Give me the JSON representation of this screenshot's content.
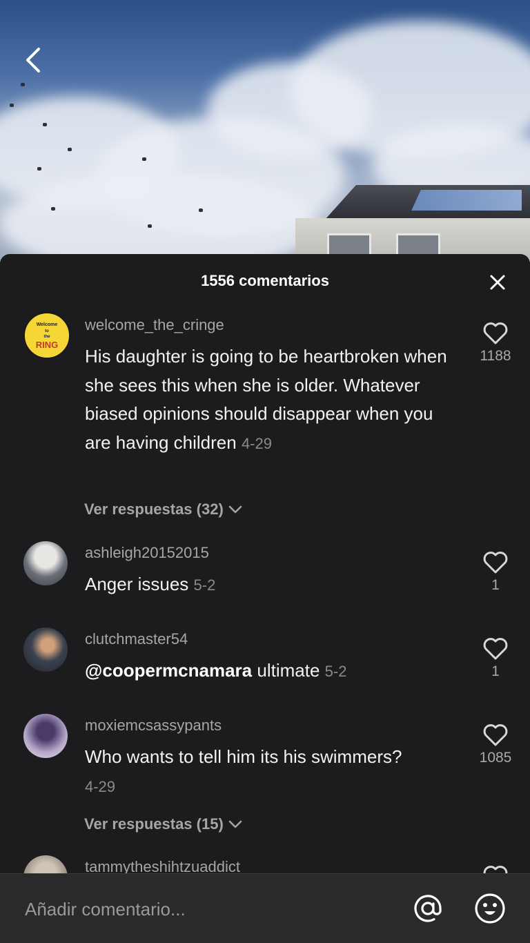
{
  "panel": {
    "title": "1556 comentarios"
  },
  "comments": [
    {
      "username": "welcome_the_cringe",
      "text": "His daughter is going to be heartbroken when she sees this when she is older. Whatever biased opinions should disappear when you are having children",
      "date": "4-29",
      "likes": "1188",
      "replies": "Ver respuestas (32)",
      "avatar_text": [
        "Welcome",
        "to",
        "the",
        "RING"
      ]
    },
    {
      "username": "ashleigh20152015",
      "text": "Anger issues",
      "date": "5-2",
      "likes": "1"
    },
    {
      "username": "clutchmaster54",
      "mention": "@coopermcnamara",
      "text": "ultimate",
      "date": "5-2",
      "likes": "1"
    },
    {
      "username": "moxiemcsassypants",
      "text": "Who wants to tell him its his swimmers?",
      "date": "4-29",
      "likes": "1085",
      "replies": "Ver respuestas (15)"
    },
    {
      "username": "tammytheshihtzuaddict"
    }
  ],
  "composer": {
    "placeholder": "Añadir comentario..."
  },
  "colors": {
    "panel_bg": "#1c1c1e",
    "text_primary": "#f2f2f2",
    "text_secondary": "#a6a6a8",
    "bar_bg": "#2a2a2c"
  },
  "icons": [
    "back-icon",
    "close-icon",
    "heart-icon",
    "chevron-down-icon",
    "at-icon",
    "emoji-icon"
  ]
}
